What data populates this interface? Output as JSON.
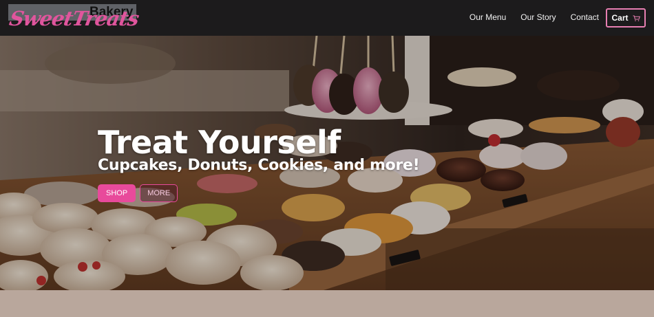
{
  "brand": {
    "script_name": "SweetTreats",
    "subtitle": "Bakery"
  },
  "nav": {
    "links": [
      "Our Menu",
      "Our Story",
      "Contact"
    ],
    "cart_label": "Cart",
    "cart_icon": "cart-icon"
  },
  "hero": {
    "title": "Treat Yourself",
    "subtitle": "Cupcakes, Donuts, Cookies, and more!",
    "primary_button": "SHOP",
    "secondary_button": "MORE"
  },
  "colors": {
    "navbar": "#1c1b1c",
    "accent_pink": "#e84a9b",
    "page_background": "#b9a79c"
  }
}
